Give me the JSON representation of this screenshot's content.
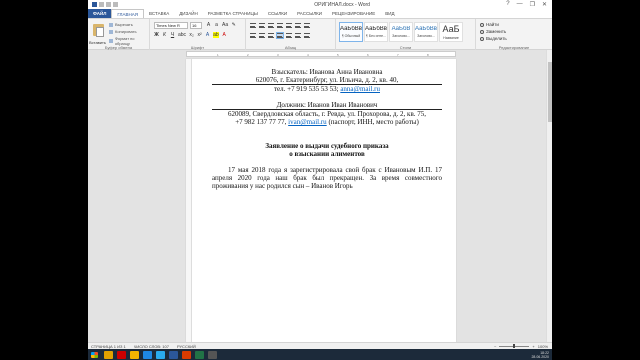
{
  "window": {
    "title": "ОРИГИНАЛ.docx - Word",
    "controls": [
      "?",
      "—",
      "❐",
      "✕"
    ]
  },
  "ribbon": {
    "tabs": [
      "ФАЙЛ",
      "ГЛАВНАЯ",
      "ВСТАВКА",
      "ДИЗАЙН",
      "РАЗМЕТКА СТРАНИЦЫ",
      "ССЫЛКИ",
      "РАССЫЛКИ",
      "РЕЦЕНЗИРОВАНИЕ",
      "ВИД"
    ],
    "active_tab": "ГЛАВНАЯ",
    "clipboard": {
      "paste": "Вставить",
      "cut": "Вырезать",
      "copy": "Копировать",
      "format_painter": "Формат по образцу",
      "label": "Буфер обмена"
    },
    "font": {
      "name": "Times New R",
      "size": "16",
      "label": "Шрифт"
    },
    "paragraph": {
      "label": "Абзац"
    },
    "styles": {
      "items": [
        {
          "sample": "АаБбВвГг,",
          "name": "¶ Обычный"
        },
        {
          "sample": "АаБбВвГ",
          "name": "¶ Без инте..."
        },
        {
          "sample": "АаБбВ",
          "name": "Заголово..."
        },
        {
          "sample": "АаБбВвГ",
          "name": "Заголово..."
        },
        {
          "sample": "АаБ",
          "name": "Название"
        }
      ],
      "label": "Стили"
    },
    "editing": {
      "find": "Найти",
      "replace": "Заменить",
      "select": "Выделить",
      "label": "Редактирование"
    }
  },
  "document": {
    "claimant": "Взыскатель: Иванова Анна Ивановна",
    "claimant_address": "620076, г. Екатеринбург, ул. Ильича, д. 2, кв. 40,",
    "claimant_phone": "тел. +7 919 535 53 53;",
    "claimant_email": "anna@mail.ru",
    "debtor": "Должник: Иванов Иван Иванович",
    "debtor_address": "620089, Свердловская область, г. Ревда, ул. Прохорова, д. 2, кв. 75,",
    "debtor_phone": "+7 982 137 77 77,",
    "debtor_email": "ivan@mail.ru",
    "debtor_note": "(паспорт, ИНН, место работы)",
    "heading_line1": "Заявление о выдачи судебного приказа",
    "heading_line2": "о взыскании алиментов",
    "body": "17 мая 2018 года я зарегистрировала свой брак с Ивановым И.П. 17 апреля 2020 года наш брак был прекращен. За время совместного проживания у нас родился сын – Иванов Игорь"
  },
  "status_bar": {
    "page": "СТРАНИЦА 1 ИЗ 1",
    "words": "ЧИСЛО СЛОВ: 107",
    "language": "РУССКИЙ",
    "zoom": "100%"
  },
  "taskbar": {
    "time": "18:22",
    "date": "28.06.2020"
  },
  "colors": {
    "word_blue": "#2b579a",
    "link": "#0563c1",
    "taskbar": "#1c2a3a"
  }
}
